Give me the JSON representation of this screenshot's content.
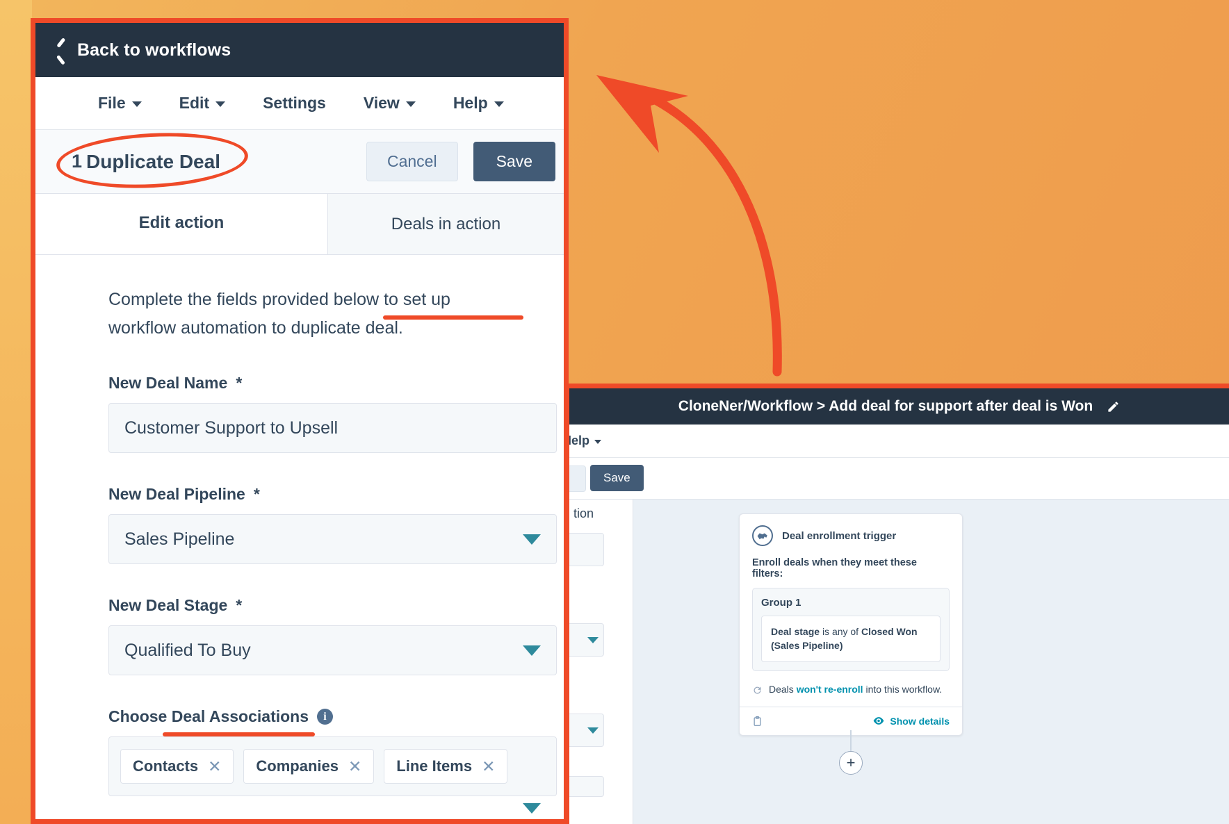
{
  "left_window": {
    "topbar": {
      "back_label": "Back to workflows",
      "back_icon": "chevron-left-icon"
    },
    "menu": [
      {
        "label": "File",
        "has_caret": true
      },
      {
        "label": "Edit",
        "has_caret": true
      },
      {
        "label": "Settings",
        "has_caret": false
      },
      {
        "label": "View",
        "has_caret": true
      },
      {
        "label": "Help",
        "has_caret": true
      }
    ],
    "title_row": {
      "index": "1",
      "title": "Duplicate Deal",
      "cancel_label": "Cancel",
      "save_label": "Save"
    },
    "tabs": [
      {
        "label": "Edit action",
        "active": true
      },
      {
        "label": "Deals in action",
        "active": false
      }
    ],
    "intro_text": "Complete the fields provided below to set up workflow automation to duplicate deal.",
    "fields": {
      "deal_name": {
        "label": "New Deal Name",
        "required_marker": "*",
        "value": "Customer Support to Upsell"
      },
      "deal_pipeline": {
        "label": "New Deal Pipeline",
        "required_marker": "*",
        "value": "Sales Pipeline"
      },
      "deal_stage": {
        "label": "New Deal Stage",
        "required_marker": "*",
        "value": "Qualified To Buy"
      },
      "associations": {
        "label": "Choose Deal Associations",
        "info_icon": "info-icon",
        "info_glyph": "i",
        "chips": [
          {
            "label": "Contacts",
            "remove_glyph": "✕"
          },
          {
            "label": "Companies",
            "remove_glyph": "✕"
          },
          {
            "label": "Line Items",
            "remove_glyph": "✕"
          }
        ]
      }
    }
  },
  "right_window": {
    "title": "CloneNer/Workflow > Add deal for support after deal is Won",
    "pencil_icon": "pencil-edit-icon",
    "menu": {
      "help_label": "Help"
    },
    "toolbar": {
      "save_label": "Save"
    },
    "side_tab_label": "tion",
    "trigger_card": {
      "icon": "handshake-icon",
      "title": "Deal enrollment trigger",
      "subtitle": "Enroll deals when they meet these filters:",
      "group_title": "Group 1",
      "filter": {
        "property": "Deal stage",
        "operator": "is any of",
        "value": "Closed Won (Sales Pipeline)"
      },
      "reenroll": {
        "icon": "refresh-icon",
        "prefix": "Deals ",
        "accent": "won't re-enroll",
        "suffix": " into this workflow."
      },
      "footer": {
        "clipboard_icon": "clipboard-icon",
        "eye_icon": "eye-icon",
        "show_details_label": "Show details"
      }
    },
    "add_step_glyph": "+"
  },
  "annotations": {
    "title_ellipse": "red-ellipse-highlight",
    "intro_underline": "red-underline-highlight",
    "assoc_underline": "red-underline-highlight",
    "arrow": "red-curved-arrow"
  },
  "colors": {
    "accent_red": "#ef4a28",
    "dark_navy": "#253342",
    "text_navy": "#33475b",
    "teal": "#0091ae",
    "save_button": "#425b76",
    "background_orange": "#ef9a4d"
  }
}
